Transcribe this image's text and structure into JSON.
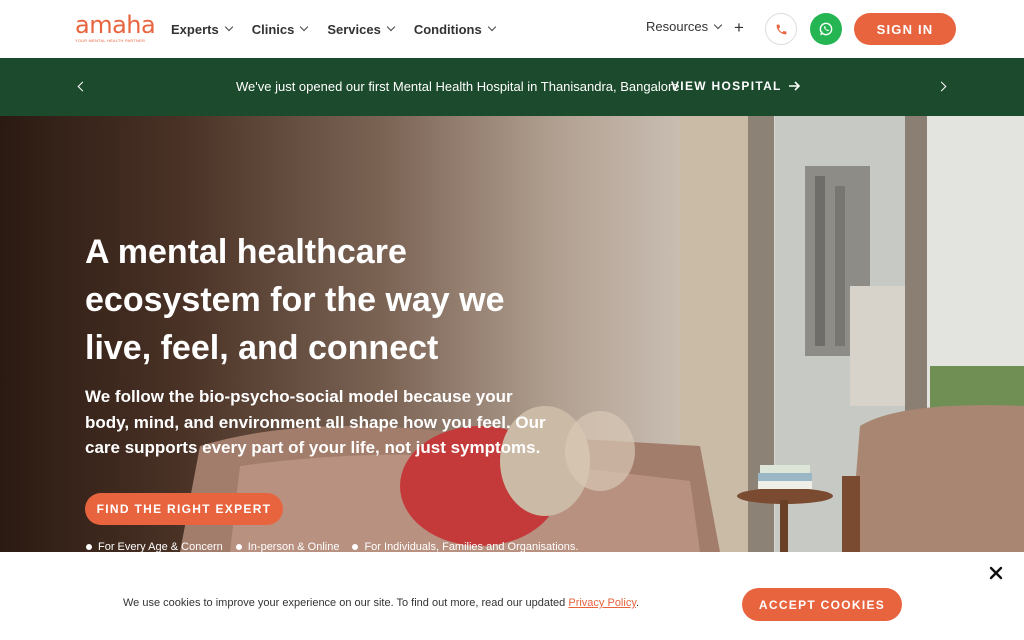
{
  "brand": {
    "logo_text": "amaha",
    "tagline": "YOUR MENTAL HEALTH PARTNER",
    "accent_color": "#e8643f"
  },
  "nav": {
    "items": [
      {
        "label": "Experts"
      },
      {
        "label": "Clinics"
      },
      {
        "label": "Services"
      },
      {
        "label": "Conditions"
      }
    ],
    "resources_label": "Resources",
    "plus_label": "+",
    "sign_in_label": "SIGN IN",
    "phone_icon": "phone-icon",
    "whatsapp_icon": "whatsapp-icon"
  },
  "announcement": {
    "text": "We've just opened our first Mental Health Hospital in Thanisandra, Bangalore",
    "link_label": "VIEW HOSPITAL",
    "background_color": "#1c4a2c"
  },
  "hero": {
    "heading": "A mental healthcare ecosystem for the way we live, feel, and connect",
    "subheading": "We follow the bio-psycho-social model because your body, mind, and environment all shape how you feel. Our care supports every part of your life, not just symptoms.",
    "cta_label": "FIND THE RIGHT EXPERT",
    "bullets": [
      "For Every Age & Concern",
      "In-person & Online",
      "For Individuals, Families and Organisations."
    ]
  },
  "cookie_banner": {
    "text_before": "We use cookies to improve your experience on our site. To find out more, read our updated ",
    "link_label": "Privacy Policy",
    "text_after": ".",
    "accept_label": "ACCEPT COOKIES"
  }
}
